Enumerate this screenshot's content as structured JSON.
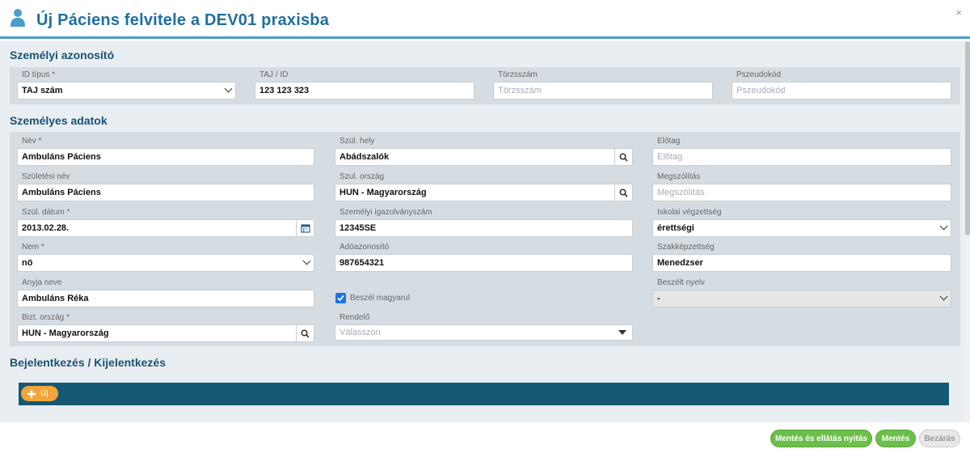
{
  "header": {
    "title": "Új Páciens felvitele a DEV01 praxisba",
    "close": "×"
  },
  "sections": {
    "personal_id": "Személyi azonosító",
    "personal_data": "Személyes adatok",
    "checkin": "Bejelentkezés / Kijelentkezés"
  },
  "id_section": {
    "id_type_label": "ID típus *",
    "id_type_value": "TAJ szám",
    "taj_label": "TAJ / ID",
    "taj_value": "123 123 323",
    "torzs_label": "Törzsszám",
    "torzs_placeholder": "Törzsszám",
    "pseudo_label": "Pszeudokód",
    "pseudo_placeholder": "Pszeudokód"
  },
  "personal": {
    "name_label": "Név *",
    "name_value": "Ambuláns Páciens",
    "birth_place_label": "Szül. hely",
    "birth_place_value": "Abádszalók",
    "prefix_label": "Előtag",
    "prefix_placeholder": "Előtag",
    "birth_name_label": "Születési név",
    "birth_name_value": "Ambuláns Páciens",
    "birth_country_label": "Szul. ország",
    "birth_country_value": "HUN - Magyarország",
    "salutation_label": "Megszólítás",
    "salutation_placeholder": "Megszólítás",
    "birth_date_label": "Szül. dátum *",
    "birth_date_value": "2013.02.28.",
    "id_card_label": "Személyi igazolványszám",
    "id_card_value": "12345SE",
    "education_label": "Iskolai végzettség",
    "education_value": "érettségi",
    "sex_label": "Nem *",
    "sex_value": "nö",
    "tax_label": "Adóazonosító",
    "tax_value": "987654321",
    "qualification_label": "Szakképzettség",
    "qualification_value": "Menedzser",
    "mother_label": "Anyja neve",
    "mother_value": "Ambuláns Réka",
    "speaks_hungarian_label": "Beszél magyarul",
    "language_label": "Beszélt nyelv",
    "language_value": "-",
    "insurance_country_label": "Bizt. ország *",
    "insurance_country_value": "HUN - Magyarország",
    "office_label": "Rendelő",
    "office_placeholder": "Válasszon"
  },
  "toolbar": {
    "add_label": "Új"
  },
  "footer": {
    "save_open_label": "Mentés és ellátás nyitás",
    "save_label": "Mentés",
    "close_label": "Bezárás"
  },
  "colors": {
    "accent": "#1f6fa0",
    "toolbar": "#155873",
    "add_button": "#f1a53a",
    "save_button": "#6cbf4a"
  }
}
